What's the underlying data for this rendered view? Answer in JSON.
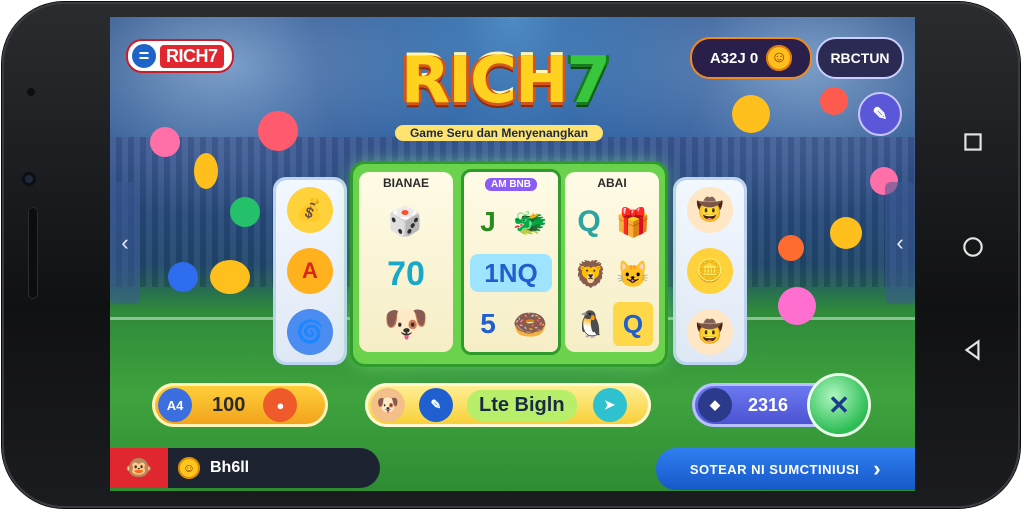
{
  "header": {
    "brand": "RICH7",
    "logo_main": "RICH",
    "logo_seven": "7",
    "tagline": "Game Seru dan Menyenangkan",
    "balance": "A32J 0",
    "account_button": "RBCTUN",
    "settings_icon": "wrench-icon"
  },
  "reels": {
    "headers": [
      "BIANAE",
      "AM BNB",
      "ABAI"
    ],
    "reel1": [
      "🎲",
      "70",
      "🐶"
    ],
    "reel2_row1": [
      "J",
      "🐲"
    ],
    "reel2_row2": "1NQ",
    "reel2_row3": [
      "5",
      "🍩"
    ],
    "reel3_row1": [
      "Q",
      "🎁"
    ],
    "reel3_row2": [
      "🦁",
      "😺"
    ],
    "reel3_row3": [
      "🐧",
      "Q"
    ],
    "left_side": [
      "💰",
      "A",
      "🌀"
    ],
    "right_side": [
      "🤠",
      "🪙",
      "🤠"
    ]
  },
  "controls": {
    "bet_chip": "A4",
    "bet_value": "100",
    "mid_label": "Lte Bigln",
    "right_value": "2316",
    "spin_icon": "wrench-icon"
  },
  "footer": {
    "player_name": "Bh6ll",
    "action_button": "SOTEAR NI SUMCTINIUSI",
    "arrow": "›"
  },
  "colors": {
    "accent_red": "#e0262f",
    "accent_green": "#2ebd55",
    "accent_blue": "#1758c9",
    "gold": "#ffd23c"
  }
}
